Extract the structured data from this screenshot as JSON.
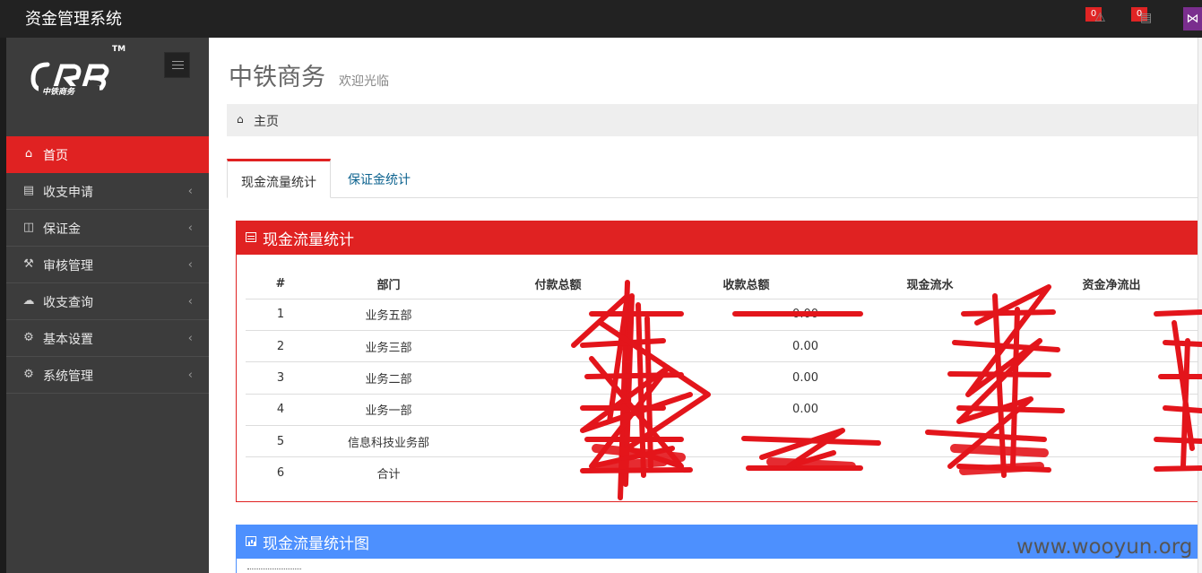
{
  "app": {
    "title": "资金管理系统"
  },
  "topbar": {
    "notifications": {
      "count": "0",
      "icon": "warning-icon"
    },
    "tasks": {
      "count": "0",
      "icon": "tasks-icon"
    }
  },
  "brand": {
    "tm": "TM"
  },
  "sidebar": {
    "items": [
      {
        "label": "首页",
        "icon": "home-icon",
        "active": true
      },
      {
        "label": "收支申请",
        "icon": "briefcase-icon"
      },
      {
        "label": "保证金",
        "icon": "money-icon"
      },
      {
        "label": "审核管理",
        "icon": "gavel-icon"
      },
      {
        "label": "收支查询",
        "icon": "cloud-icon"
      },
      {
        "label": "基本设置",
        "icon": "cogs-icon"
      },
      {
        "label": "系统管理",
        "icon": "cog-icon"
      }
    ]
  },
  "page": {
    "title": "中铁商务",
    "subtitle": "欢迎光临"
  },
  "breadcrumb": {
    "home": "主页"
  },
  "tabs": [
    {
      "label": "现金流量统计",
      "active": true
    },
    {
      "label": "保证金统计",
      "active": false
    }
  ],
  "cashflow": {
    "title": "现金流量统计",
    "headers": [
      "#",
      "部门",
      "付款总额",
      "收款总额",
      "现金流水",
      "资金净流出"
    ],
    "rows": [
      {
        "no": "1",
        "dept": "业务五部",
        "paid": "",
        "received": "0.00",
        "flow": "",
        "net": ""
      },
      {
        "no": "2",
        "dept": "业务三部",
        "paid": "",
        "received": "0.00",
        "flow": "",
        "net": ""
      },
      {
        "no": "3",
        "dept": "业务二部",
        "paid": "",
        "received": "0.00",
        "flow": "",
        "net": ""
      },
      {
        "no": "4",
        "dept": "业务一部",
        "paid": "",
        "received": "0.00",
        "flow": "",
        "net": ""
      },
      {
        "no": "5",
        "dept": "信息科技业务部",
        "paid": "",
        "received": "",
        "flow": "",
        "net": ""
      },
      {
        "no": "6",
        "dept": "合计",
        "paid": "",
        "received": "",
        "flow": "",
        "net": ""
      }
    ]
  },
  "cashflow_chart": {
    "title": "现金流量统计图"
  },
  "watermark": "www.wooyun.org",
  "colors": {
    "accent": "#e02222",
    "blue": "#4d90fe",
    "sidebar": "#3c3c3c",
    "topbar": "#222222"
  }
}
